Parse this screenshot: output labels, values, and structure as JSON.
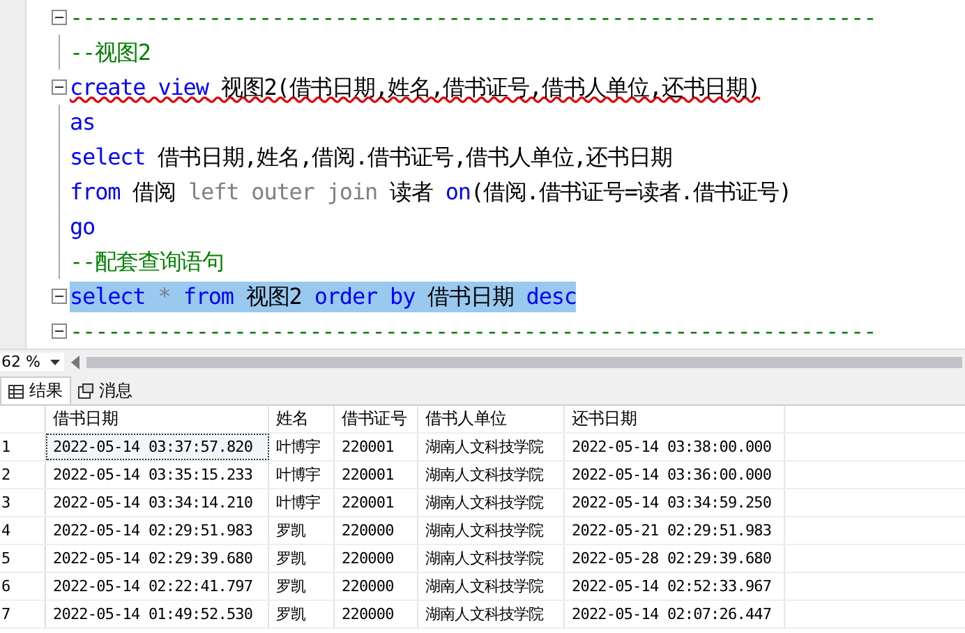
{
  "editor": {
    "lines": [
      {
        "fold": true,
        "tokens": [
          {
            "kind": "comment",
            "text": "----------------------------------------------------------------"
          }
        ]
      },
      {
        "fold": false,
        "tokens": [
          {
            "kind": "comment",
            "text": "--视图2"
          }
        ]
      },
      {
        "fold": true,
        "error": true,
        "tokens": [
          {
            "kind": "keyword",
            "text": "create view"
          },
          {
            "kind": "plain",
            "text": " 视图2(借书日期,姓名,借书证号,借书人单位,还书日期)"
          }
        ]
      },
      {
        "fold": false,
        "tokens": [
          {
            "kind": "keyword",
            "text": "as"
          }
        ]
      },
      {
        "fold": false,
        "tokens": [
          {
            "kind": "keyword",
            "text": "select"
          },
          {
            "kind": "plain",
            "text": " 借书日期,姓名,借阅.借书证号,借书人单位,还书日期"
          }
        ]
      },
      {
        "fold": false,
        "tokens": [
          {
            "kind": "keyword",
            "text": "from"
          },
          {
            "kind": "plain",
            "text": " 借阅 "
          },
          {
            "kind": "gray",
            "text": "left outer join"
          },
          {
            "kind": "plain",
            "text": " 读者 "
          },
          {
            "kind": "keyword",
            "text": "on"
          },
          {
            "kind": "plain",
            "text": "(借阅.借书证号=读者.借书证号)"
          }
        ]
      },
      {
        "fold": false,
        "tokens": [
          {
            "kind": "keyword",
            "text": "go"
          }
        ]
      },
      {
        "fold": false,
        "tokens": [
          {
            "kind": "comment",
            "text": "--配套查询语句"
          }
        ]
      },
      {
        "fold": true,
        "selected": true,
        "tokens": [
          {
            "kind": "keyword",
            "text": "select "
          },
          {
            "kind": "gray",
            "text": "* "
          },
          {
            "kind": "keyword",
            "text": "from"
          },
          {
            "kind": "plain",
            "text": " 视图2 "
          },
          {
            "kind": "keyword",
            "text": "order by"
          },
          {
            "kind": "plain",
            "text": " 借书日期 "
          },
          {
            "kind": "keyword",
            "text": "desc"
          }
        ]
      },
      {
        "fold": true,
        "tokens": [
          {
            "kind": "comment",
            "text": "----------------------------------------------------------------"
          }
        ]
      }
    ],
    "zoom": "62 %"
  },
  "tabs": [
    {
      "label": "结果",
      "selected": true
    },
    {
      "label": "消息",
      "selected": false
    }
  ],
  "table": {
    "columns": [
      "借书日期",
      "姓名",
      "借书证号",
      "借书人单位",
      "还书日期"
    ],
    "rows": [
      {
        "number": "1",
        "focused": true,
        "cells": [
          "2022-05-14 03:37:57.820",
          "叶博宇",
          "220001",
          "湖南人文科技学院",
          "2022-05-14 03:38:00.000"
        ]
      },
      {
        "number": "2",
        "focused": false,
        "cells": [
          "2022-05-14 03:35:15.233",
          "叶博宇",
          "220001",
          "湖南人文科技学院",
          "2022-05-14 03:36:00.000"
        ]
      },
      {
        "number": "3",
        "focused": false,
        "cells": [
          "2022-05-14 03:34:14.210",
          "叶博宇",
          "220001",
          "湖南人文科技学院",
          "2022-05-14 03:34:59.250"
        ]
      },
      {
        "number": "4",
        "focused": false,
        "cells": [
          "2022-05-14 02:29:51.983",
          "罗凯",
          "220000",
          "湖南人文科技学院",
          "2022-05-21 02:29:51.983"
        ]
      },
      {
        "number": "5",
        "focused": false,
        "cells": [
          "2022-05-14 02:29:39.680",
          "罗凯",
          "220000",
          "湖南人文科技学院",
          "2022-05-28 02:29:39.680"
        ]
      },
      {
        "number": "6",
        "focused": false,
        "cells": [
          "2022-05-14 02:22:41.797",
          "罗凯",
          "220000",
          "湖南人文科技学院",
          "2022-05-14 02:52:33.967"
        ]
      },
      {
        "number": "7",
        "focused": false,
        "cells": [
          "2022-05-14 01:49:52.530",
          "罗凯",
          "220000",
          "湖南人文科技学院",
          "2022-05-14 02:07:26.447"
        ]
      }
    ]
  }
}
